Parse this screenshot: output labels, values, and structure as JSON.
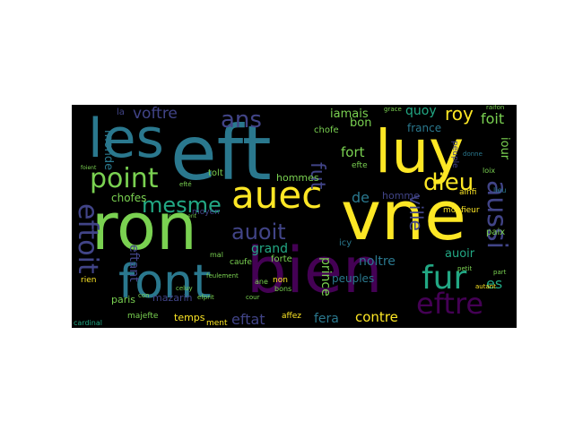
{
  "palette": {
    "background": "#000000",
    "page": "#ffffff",
    "yellow": "#fde725",
    "green": "#7ad151",
    "teal": "#22a884",
    "blue": "#2a788e",
    "indigo": "#414487",
    "purple": "#440154"
  },
  "words": {
    "eft": "eft",
    "vne": "vne",
    "bien": "bien",
    "ron": "ron",
    "font": "font",
    "luy": "luy",
    "les": "les",
    "auec": "auec",
    "point": "point",
    "dieu": "dieu",
    "mesme": "mesme",
    "fur": "fur",
    "eftre": "eftre",
    "aussi": "aussi",
    "eftoit": "eftoit",
    "ans": "ans",
    "auoit": "auoit",
    "fut": "fut",
    "roy": "roy",
    "foit": "foit",
    "voftre": "voftre",
    "iamais": "iamais",
    "quoy": "quoy",
    "fort": "fort",
    "bon": "bon",
    "france": "france",
    "choses": "chofes",
    "prince": "prince",
    "grand": "grand",
    "noltre": "noltre",
    "ville": "ville",
    "peuples": "peuples",
    "contre": "contre",
    "sera": "fera",
    "paris": "paris",
    "temps": "temps",
    "mazarin": "mazarin",
    "eftat": "eftat",
    "monde": "monde",
    "eftant": "eftant",
    "majefte": "majefte",
    "hommes": "hommes",
    "de": "de",
    "homme": "homme",
    "auoir": "auoir",
    "paix": "paix",
    "jour": "iour",
    "raifon": "raifon",
    "cardinal": "cardinal",
    "affez": "affez",
    "forte": "forte",
    "caufe": "caufe",
    "nous": "non",
    "es": "es",
    "moyen": "moyen",
    "tout": "tolt",
    "choie": "chofe",
    "elle": "efte",
    "icy": "icy",
    "la": "la",
    "rien": "rien",
    "ament": "ment",
    "bons": "bons",
    "ane": "ane",
    "loix": "loix",
    "ainfi": "ainfi",
    "part": "part",
    "autant": "autant",
    "donne": "donne",
    "grace": "grace",
    "petit": "petit",
    "lieu": "lieu",
    "peuple": "peuple",
    "monfieur": "monfieur",
    "con": "con",
    "celuy": "celuy",
    "efte": "efté",
    "feulement": "feulement",
    "efprit": "efprit",
    "cour": "cour",
    "mal": "mal",
    "parlement": "parlement",
    "roy2": "roy",
    "foient": "foient"
  }
}
